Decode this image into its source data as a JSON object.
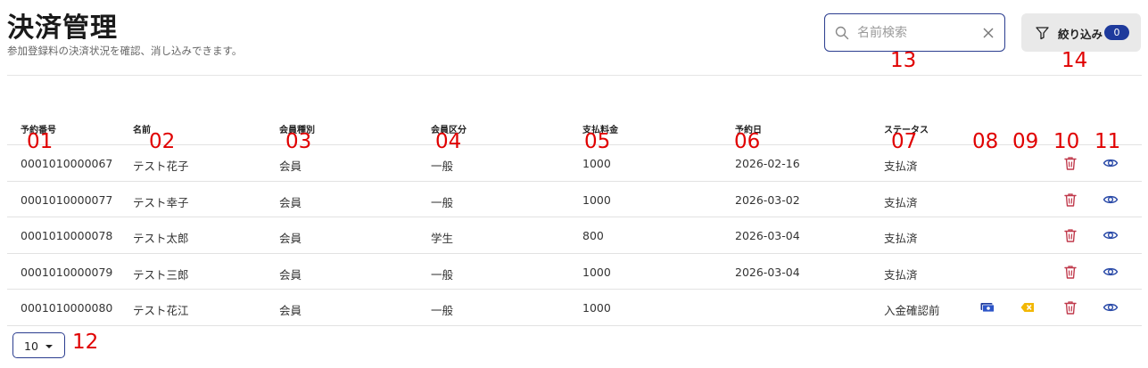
{
  "header": {
    "title": "決済管理",
    "subtitle": "参加登録料の決済状況を確認、消し込みできます。"
  },
  "search": {
    "placeholder": "名前検索",
    "value": ""
  },
  "filter": {
    "label": "絞り込み",
    "count": "0"
  },
  "table": {
    "columns": [
      "予約番号",
      "名前",
      "会員種別",
      "会員区分",
      "支払料金",
      "予約日",
      "ステータス"
    ],
    "rows": [
      {
        "id": "0001010000067",
        "name": "テスト花子",
        "type": "会員",
        "category": "一般",
        "fee": "1000",
        "date": "2026-02-16",
        "status": "支払済",
        "actions": [
          "delete",
          "view"
        ]
      },
      {
        "id": "0001010000077",
        "name": "テスト幸子",
        "type": "会員",
        "category": "一般",
        "fee": "1000",
        "date": "2026-03-02",
        "status": "支払済",
        "actions": [
          "delete",
          "view"
        ]
      },
      {
        "id": "0001010000078",
        "name": "テスト太郎",
        "type": "会員",
        "category": "学生",
        "fee": "800",
        "date": "2026-03-04",
        "status": "支払済",
        "actions": [
          "delete",
          "view"
        ]
      },
      {
        "id": "0001010000079",
        "name": "テスト三郎",
        "type": "会員",
        "category": "一般",
        "fee": "1000",
        "date": "2026-03-04",
        "status": "支払済",
        "actions": [
          "delete",
          "view"
        ]
      },
      {
        "id": "0001010000080",
        "name": "テスト花江",
        "type": "会員",
        "category": "一般",
        "fee": "1000",
        "date": "",
        "status": "入金確認前",
        "actions": [
          "confirm-payment",
          "cancel",
          "delete",
          "view"
        ]
      }
    ]
  },
  "pagination": {
    "page_size": "10"
  },
  "markers": [
    "01",
    "02",
    "03",
    "04",
    "05",
    "06",
    "07",
    "08",
    "09",
    "10",
    "11",
    "12",
    "13",
    "14"
  ],
  "colors": {
    "accent": "#1e3a9c",
    "border": "#2b3d8f",
    "delete": "#c0394b",
    "cancel": "#f2b705",
    "marker": "#e00000"
  },
  "icons": {
    "search": "search-icon",
    "clear": "close-icon",
    "filter": "funnel-icon",
    "delete": "trash-icon",
    "view": "eye-icon",
    "confirm": "cash-icon",
    "cancel": "backspace-icon",
    "caret": "caret-down-icon"
  }
}
